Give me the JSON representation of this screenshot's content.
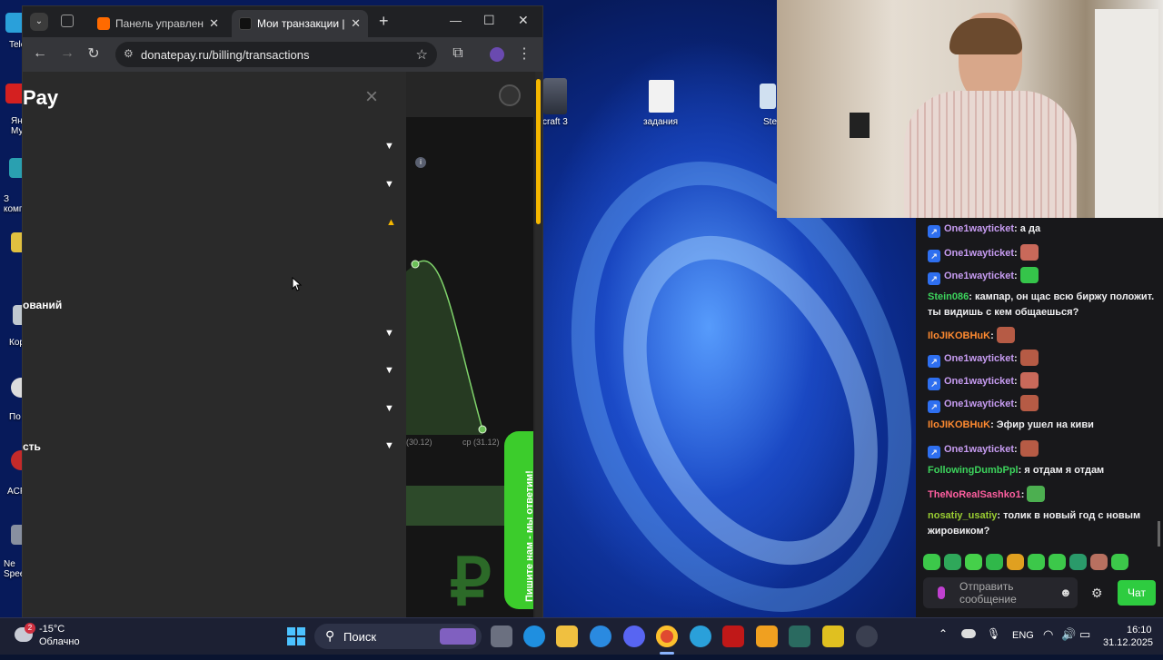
{
  "browser": {
    "tabs": [
      {
        "label": "Панель управления -",
        "favicon_color": "#ff6a00"
      },
      {
        "label": "Мои транзакции | Do",
        "favicon_color": "#111111",
        "active": true
      }
    ],
    "url": "donatepay.ru/billing/transactions",
    "new_tab": "+",
    "window_controls": {
      "minimize": "—",
      "maximize": "☐",
      "close": "✕"
    }
  },
  "page": {
    "logo_partial": "Pay",
    "close_glyph": "×",
    "section_1": "ований",
    "section_2": "сть",
    "chart": {
      "x_labels": [
        "(30.12)",
        "ср (31.12)"
      ],
      "accent": "#7fd36b"
    },
    "feedback_label": "Пишите нам - мы ответим!",
    "currency_glyph": "₽"
  },
  "desktop": {
    "left_labels": [
      "Tele",
      "Ян Му",
      "З комп",
      "Кор",
      "По",
      "ACF",
      "Ne Spee"
    ],
    "icons": [
      {
        "label": "craft 3"
      },
      {
        "label": "задания"
      },
      {
        "label": "Ste"
      }
    ]
  },
  "chat": {
    "messages": [
      {
        "user": "One1wayticket",
        "text": "а да",
        "color": "#c79cf2",
        "badge": true
      },
      {
        "user": "One1wayticket",
        "text": "",
        "emote": "#c9695a",
        "color": "#c79cf2",
        "badge": true
      },
      {
        "user": "One1wayticket",
        "text": "",
        "emote": "#35c44a",
        "color": "#c79cf2",
        "badge": true
      },
      {
        "user": "Stein086",
        "text": "кампар, он щас всю биржу положит. ты видишь с кем общаешься?",
        "color": "#3cd35c",
        "badge": false
      },
      {
        "user": "IloJIKOBHuK",
        "text": "",
        "emote": "#b65b45",
        "color": "#ff8a30",
        "badge": false
      },
      {
        "user": "One1wayticket",
        "text": "",
        "emote": "#b65b45",
        "color": "#c79cf2",
        "badge": true
      },
      {
        "user": "One1wayticket",
        "text": "",
        "emote": "#c9695a",
        "color": "#c79cf2",
        "badge": true
      },
      {
        "user": "One1wayticket",
        "text": "",
        "emote": "#b65b45",
        "color": "#c79cf2",
        "badge": true
      },
      {
        "user": "IloJIKOBHuK",
        "text": "Эфир ушел на киви",
        "color": "#ff8a30",
        "badge": false
      },
      {
        "user": "One1wayticket",
        "text": "",
        "emote": "#b65b45",
        "color": "#c79cf2",
        "badge": true
      },
      {
        "user": "FollowingDumbPpl",
        "text": "я отдам я отдам",
        "color": "#3cd35c",
        "badge": false
      },
      {
        "user": "TheNoRealSashko1",
        "text": "",
        "emote": "#4caf50",
        "color": "#ff5fa0",
        "badge": false
      },
      {
        "user": "nosatiy_usatiy",
        "text": "толик в новый год с новым жировиком?",
        "color": "#9acd32",
        "badge": false
      }
    ],
    "input_placeholder": "Отправить сообщение",
    "send_label": "Чат",
    "emote_colors": [
      "#3cc84a",
      "#2fa85a",
      "#45d04a",
      "#30b84a",
      "#e0a020",
      "#3cc84a",
      "#3cc84a",
      "#2a9a6a",
      "#b87060",
      "#3cc84a"
    ]
  },
  "taskbar": {
    "weather_temp": "-15°C",
    "weather_desc": "Облачно",
    "weather_badge": "2",
    "search_placeholder": "Поиск",
    "language": "ENG",
    "time": "16:10",
    "date": "31.12.2025"
  }
}
